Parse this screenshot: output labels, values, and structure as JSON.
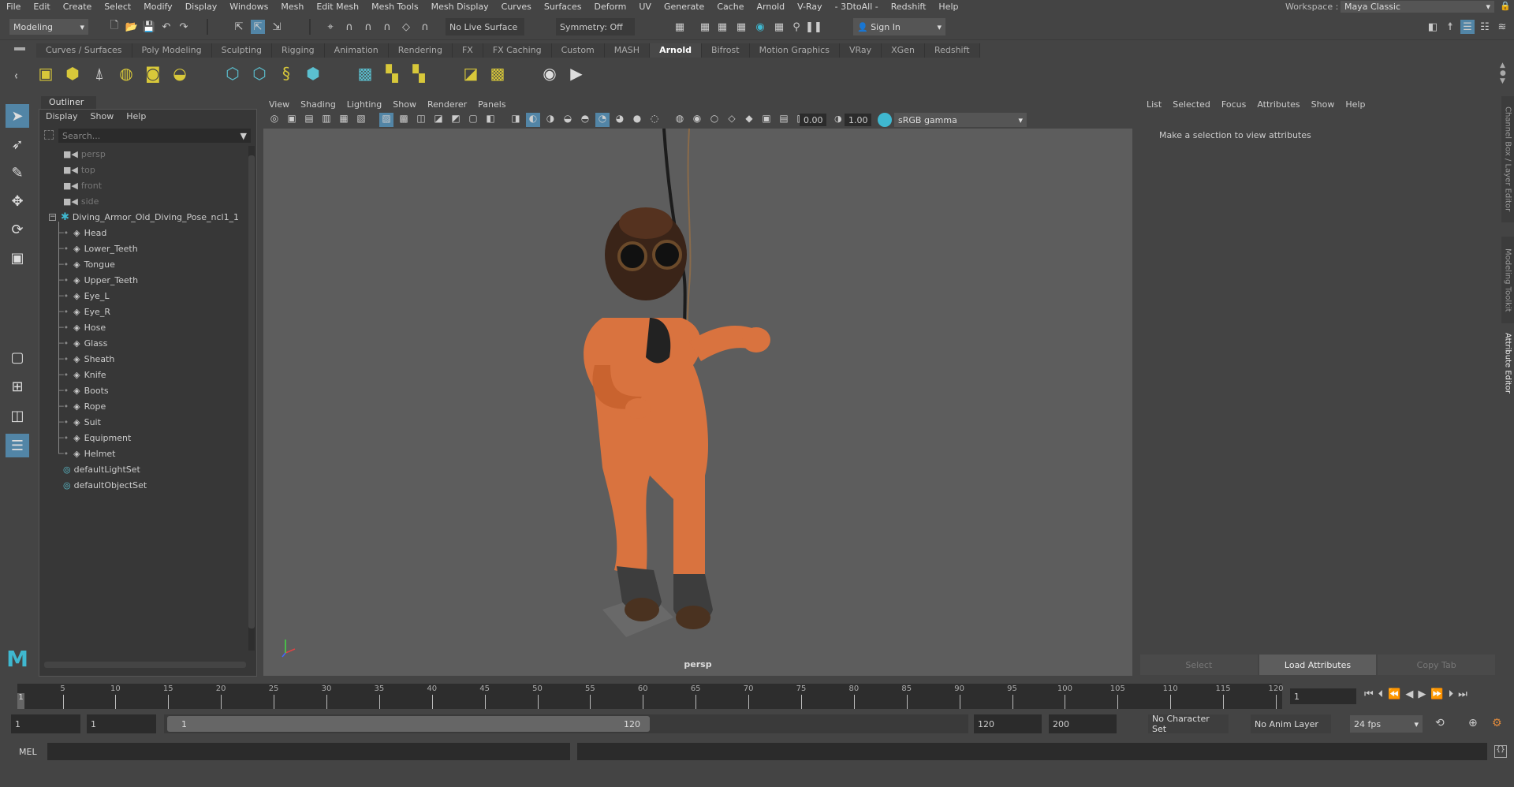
{
  "menubar": {
    "items": [
      "File",
      "Edit",
      "Create",
      "Select",
      "Modify",
      "Display",
      "Windows",
      "Mesh",
      "Edit Mesh",
      "Mesh Tools",
      "Mesh Display",
      "Curves",
      "Surfaces",
      "Deform",
      "UV",
      "Generate",
      "Cache",
      "Arnold",
      "V-Ray",
      "- 3DtoAll -",
      "Redshift",
      "Help"
    ],
    "workspace_label": "Workspace :",
    "workspace_value": "Maya Classic"
  },
  "status": {
    "mode": "Modeling",
    "live_surface": "No Live Surface",
    "symmetry": "Symmetry: Off",
    "sign_in": "Sign In"
  },
  "shelf": {
    "tabs": [
      "Curves / Surfaces",
      "Poly Modeling",
      "Sculpting",
      "Rigging",
      "Animation",
      "Rendering",
      "FX",
      "FX Caching",
      "Custom",
      "MASH",
      "Arnold",
      "Bifrost",
      "Motion Graphics",
      "VRay",
      "XGen",
      "Redshift"
    ],
    "active": "Arnold"
  },
  "outliner": {
    "title": "Outliner",
    "menus": [
      "Display",
      "Show",
      "Help"
    ],
    "search_placeholder": "Search...",
    "cameras": [
      "persp",
      "top",
      "front",
      "side"
    ],
    "group": "Diving_Armor_Old_Diving_Pose_ncl1_1",
    "children": [
      "Head",
      "Lower_Teeth",
      "Tongue",
      "Upper_Teeth",
      "Eye_L",
      "Eye_R",
      "Hose",
      "Glass",
      "Sheath",
      "Knife",
      "Boots",
      "Rope",
      "Suit",
      "Equipment",
      "Helmet"
    ],
    "sets": [
      "defaultLightSet",
      "defaultObjectSet"
    ]
  },
  "viewport": {
    "menus": [
      "View",
      "Shading",
      "Lighting",
      "Show",
      "Renderer",
      "Panels"
    ],
    "exposure": "0.00",
    "gamma": "1.00",
    "color_space": "sRGB gamma",
    "camera_label": "persp"
  },
  "attribute_editor": {
    "menus": [
      "List",
      "Selected",
      "Focus",
      "Attributes",
      "Show",
      "Help"
    ],
    "message": "Make a selection to view attributes",
    "buttons": [
      "Select",
      "Load Attributes",
      "Copy Tab"
    ]
  },
  "side_tabs": [
    "Channel Box / Layer Editor",
    "Modeling Toolkit",
    "Attribute Editor"
  ],
  "timeline": {
    "start": 1,
    "end": 120,
    "current_frame": "1",
    "current_frame_marker": "1"
  },
  "range": {
    "start": "1",
    "playback_start": "1",
    "slider_start": "1",
    "slider_end": "120",
    "playback_end": "120",
    "end": "200",
    "character_set": "No Character Set",
    "anim_layer": "No Anim Layer",
    "fps": "24 fps"
  },
  "cmdline": {
    "label": "MEL"
  },
  "colors": {
    "accent": "#5285a6",
    "viewport_bg": "#5d5d5d",
    "suit": "#d9733f"
  }
}
